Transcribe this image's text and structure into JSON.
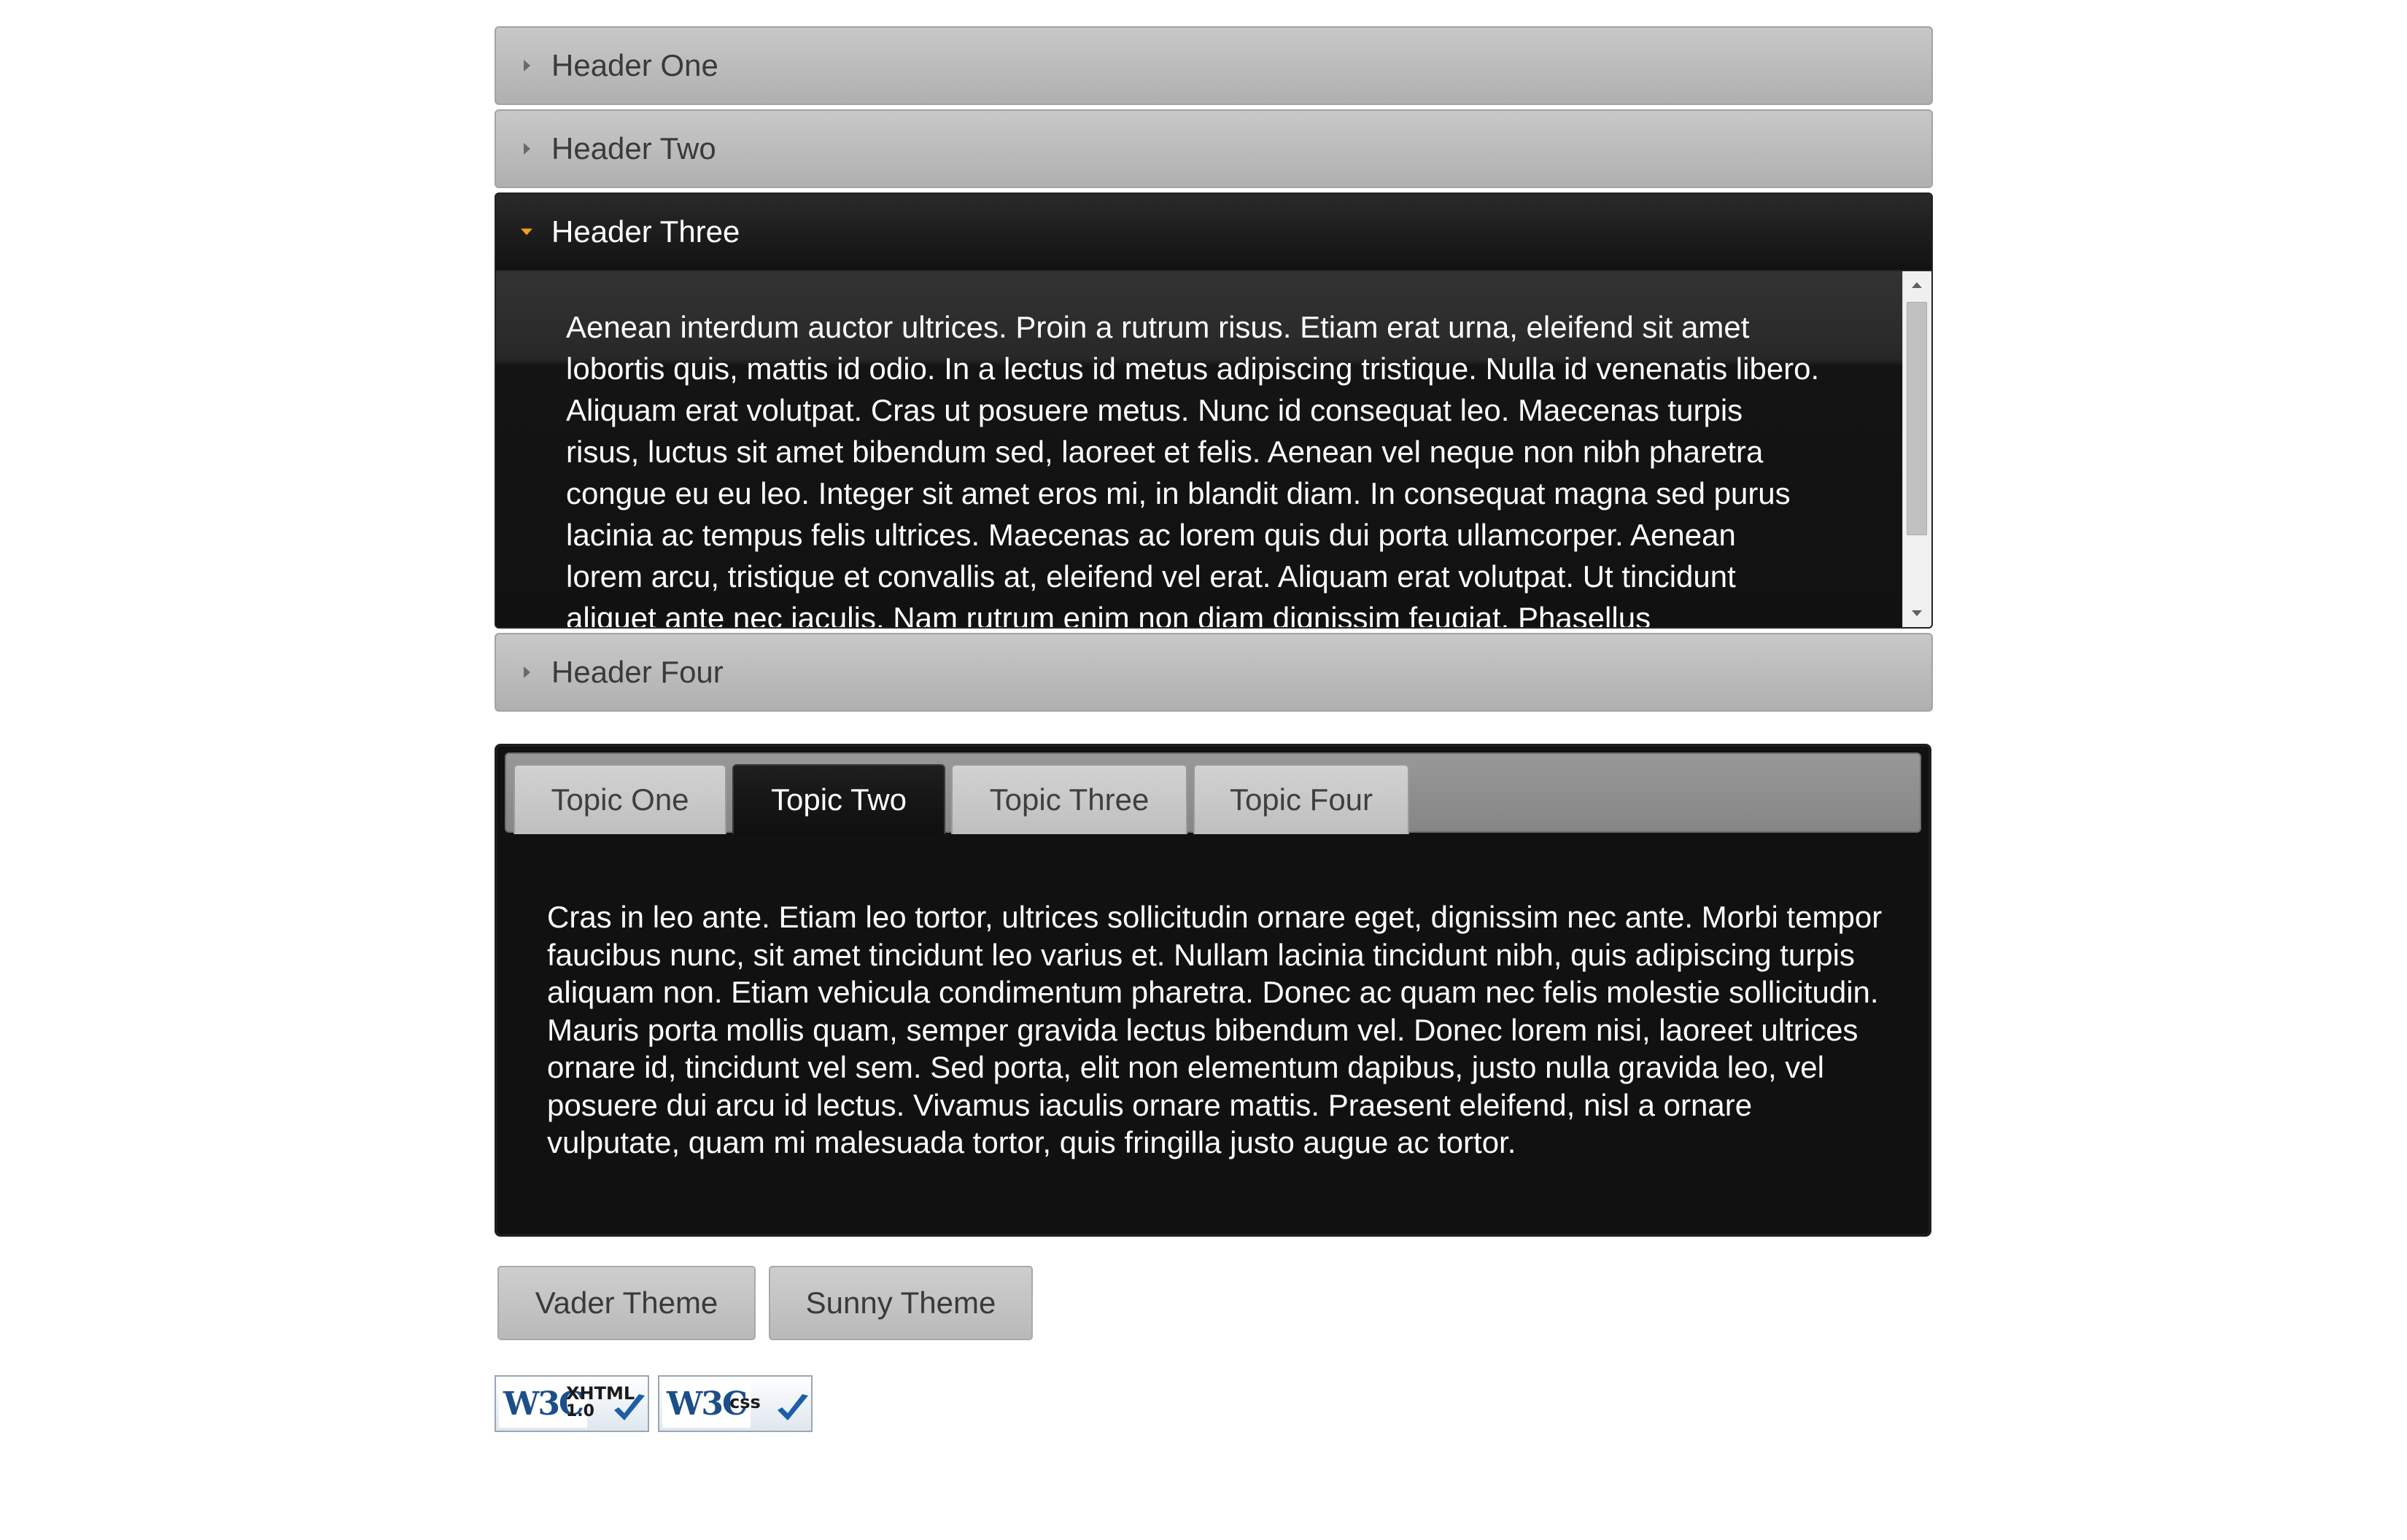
{
  "accordion": {
    "headers": [
      {
        "label": "Header One",
        "state": "collapsed"
      },
      {
        "label": "Header Two",
        "state": "collapsed"
      },
      {
        "label": "Header Three",
        "state": "expanded"
      },
      {
        "label": "Header Four",
        "state": "collapsed"
      }
    ],
    "active_panel_text": "Aenean interdum auctor ultrices. Proin a rutrum risus. Etiam erat urna, eleifend sit amet lobortis quis, mattis id odio. In a lectus id metus adipiscing tristique. Nulla id venenatis libero. Aliquam erat volutpat. Cras ut posuere metus. Nunc id consequat leo. Maecenas turpis risus, luctus sit amet bibendum sed, laoreet et felis. Aenean vel neque non nibh pharetra congue eu eu leo. Integer sit amet eros mi, in blandit diam. In consequat magna sed purus lacinia ac tempus felis ultrices. Maecenas ac lorem quis dui porta ullamcorper. Aenean lorem arcu, tristique et convallis at, eleifend vel erat. Aliquam erat volutpat. Ut tincidunt aliquet ante nec iaculis. Nam rutrum enim non diam dignissim feugiat. Phasellus"
  },
  "tabs": {
    "items": [
      {
        "label": "Topic One"
      },
      {
        "label": "Topic Two"
      },
      {
        "label": "Topic Three"
      },
      {
        "label": "Topic Four"
      }
    ],
    "active_index": 1,
    "content": "Cras in leo ante. Etiam leo tortor, ultrices sollicitudin ornare eget, dignissim nec ante. Morbi tempor faucibus nunc, sit amet tincidunt leo varius et. Nullam lacinia tincidunt nibh, quis adipiscing turpis aliquam non. Etiam vehicula condimentum pharetra. Donec ac quam nec felis molestie sollicitudin. Mauris porta mollis quam, semper gravida lectus bibendum vel. Donec lorem nisi, laoreet ultrices ornare id, tincidunt vel sem. Sed porta, elit non elementum dapibus, justo nulla gravida leo, vel posuere dui arcu id lectus. Vivamus iaculis ornare mattis. Praesent eleifend, nisl a ornare vulputate, quam mi malesuada tortor, quis fringilla justo augue ac tortor."
  },
  "theme_buttons": {
    "vader": "Vader Theme",
    "sunny": "Sunny Theme"
  },
  "badges": {
    "xhtml": {
      "logo": "W3C",
      "line1": "XHTML",
      "line2": "1.0"
    },
    "css": {
      "logo": "W3C",
      "line1": "css"
    }
  },
  "colors": {
    "active_arrow": "#f0a01a",
    "badge_check": "#1c5fa8"
  }
}
